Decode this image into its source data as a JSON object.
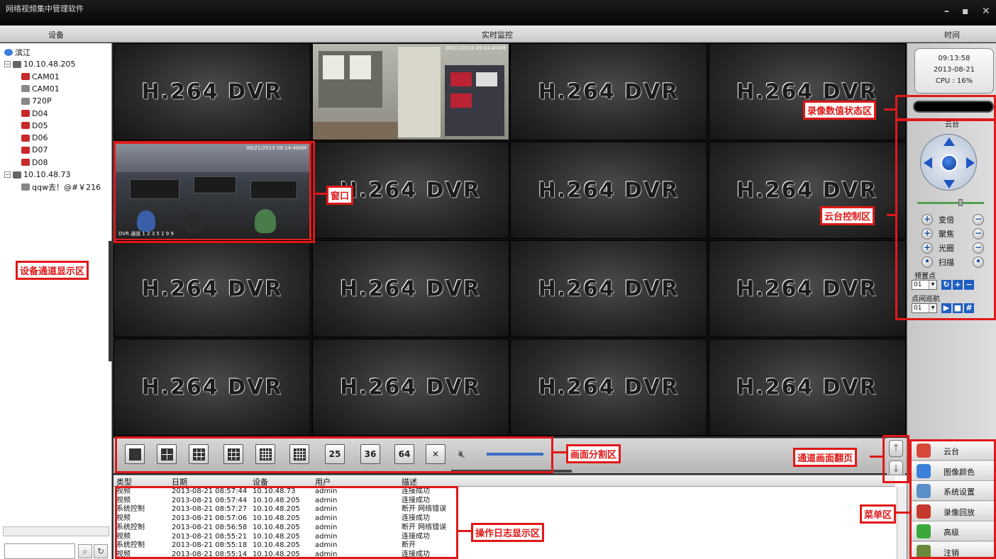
{
  "app": {
    "title": "网络视频集中管理软件",
    "window_controls": [
      "–",
      "▪",
      "✕"
    ]
  },
  "header": {
    "device_label": "设备",
    "monitor_label": "实时监控",
    "time_label": "时间"
  },
  "device_tree": [
    {
      "label": "滨江",
      "icon": "globe-icon",
      "level": 0
    },
    {
      "label": "10.10.48.205",
      "icon": "dvr-icon",
      "level": 0,
      "expander": "⊟"
    },
    {
      "label": "CAM01",
      "icon": "camera-offline-icon",
      "level": 1
    },
    {
      "label": "CAM01",
      "icon": "camera-icon",
      "level": 1
    },
    {
      "label": "720P",
      "icon": "camera-icon",
      "level": 1
    },
    {
      "label": "D04",
      "icon": "camera-offline-icon",
      "level": 1
    },
    {
      "label": "D05",
      "icon": "camera-offline-icon",
      "level": 1
    },
    {
      "label": "D06",
      "icon": "camera-offline-icon",
      "level": 1
    },
    {
      "label": "D07",
      "icon": "camera-offline-icon",
      "level": 1
    },
    {
      "label": "D08",
      "icon": "camera-offline-icon",
      "level": 1
    },
    {
      "label": "10.10.48.73",
      "icon": "dvr-icon",
      "level": 0,
      "expander": "⊟"
    },
    {
      "label": "qqw去！@#￥216",
      "icon": "camera-icon",
      "level": 1
    }
  ],
  "video": {
    "logo_text": "H.264 DVR",
    "office_timestamp": "08/21/2013 09:14:40AM",
    "meeting_timestamp": "08/21/2013 09:14:40AM",
    "meeting_caption": "DVR 通道 1 2 3 5 1 9 9"
  },
  "split_buttons": [
    "1",
    "4",
    "6",
    "9",
    "13",
    "16",
    "25",
    "36",
    "64"
  ],
  "log": {
    "columns": [
      "类型",
      "日期",
      "设备",
      "用户",
      "描述"
    ],
    "rows": [
      [
        "视频",
        "2013-08-21 08:57:44",
        "10.10.48.73",
        "admin",
        "连接成功"
      ],
      [
        "视频",
        "2013-08-21 08:57:44",
        "10.10.48.205",
        "admin",
        "连接成功"
      ],
      [
        "系统控制",
        "2013-08-21 08:57:27",
        "10.10.48.205",
        "admin",
        "断开 网络错误"
      ],
      [
        "视频",
        "2013-08-21 08:57:06",
        "10.10.48.205",
        "admin",
        "连接成功"
      ],
      [
        "系统控制",
        "2013-08-21 08:56:58",
        "10.10.48.205",
        "admin",
        "断开 网络错误"
      ],
      [
        "视频",
        "2013-08-21 08:55:21",
        "10.10.48.205",
        "admin",
        "连接成功"
      ],
      [
        "系统控制",
        "2013-08-21 08:55:18",
        "10.10.48.205",
        "admin",
        "断开"
      ],
      [
        "视频",
        "2013-08-21 08:55:14",
        "10.10.48.205",
        "admin",
        "连接成功"
      ]
    ]
  },
  "status": {
    "time": "09:13:58",
    "date": "2013-08-21",
    "cpu": "CPU : 16%"
  },
  "ptz": {
    "title": "云台",
    "rows": [
      {
        "label": "变倍",
        "left": "+",
        "right": "−"
      },
      {
        "label": "聚焦",
        "left": "+",
        "right": "−"
      },
      {
        "label": "光圈",
        "left": "+",
        "right": "−"
      },
      {
        "label": "扫描",
        "left": "•",
        "right": "•"
      }
    ],
    "preset_label": "预置点",
    "preset_value": "01",
    "cruise_label": "点间巡航",
    "cruise_value": "01"
  },
  "menu": [
    {
      "label": "云台",
      "icon": "ptz-icon",
      "color": "#d8493a"
    },
    {
      "label": "图像颜色",
      "icon": "color-icon",
      "color": "#3a7fd8"
    },
    {
      "label": "系统设置",
      "icon": "settings-icon",
      "color": "#5a8fc8"
    },
    {
      "label": "录像回放",
      "icon": "playback-icon",
      "color": "#c8372d"
    },
    {
      "label": "高级",
      "icon": "advanced-icon",
      "color": "#3aa83a"
    },
    {
      "label": "注销",
      "icon": "logout-icon",
      "color": "#6a8a3a"
    }
  ],
  "annotations": {
    "device_area": "设备通道显示区",
    "window": "窗口",
    "record_status": "录像数值状态区",
    "ptz_area": "云台控制区",
    "split_area": "画面分割区",
    "page_flip": "通道画面翻页",
    "menu_area": "菜单区",
    "log_area": "操作日志显示区"
  },
  "colors": {
    "annotation": "#e01818",
    "accent_blue": "#1f5fc4"
  }
}
